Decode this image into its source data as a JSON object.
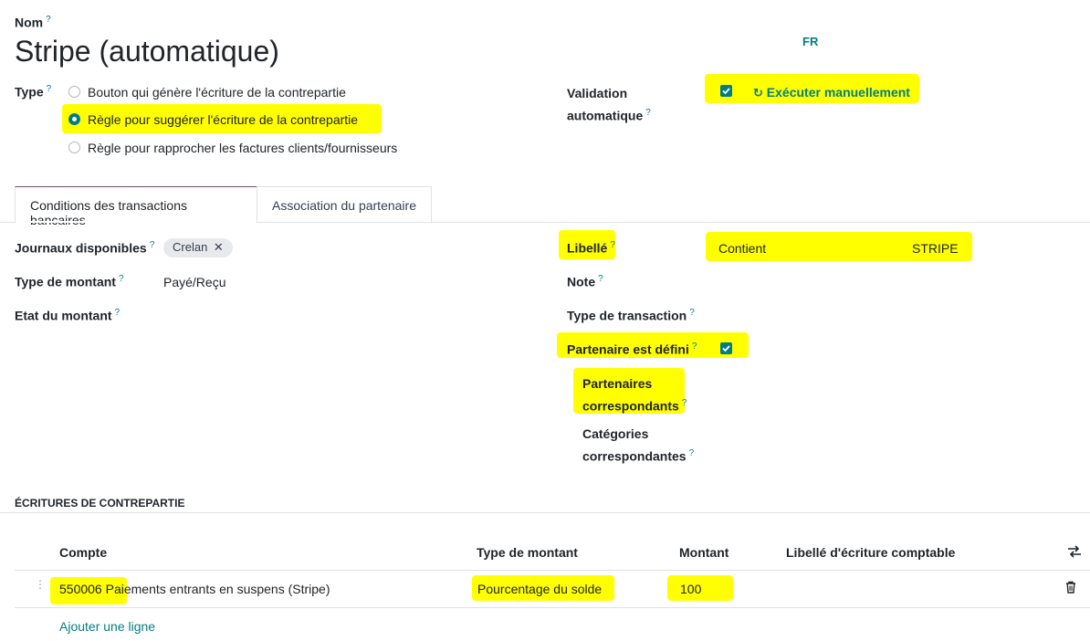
{
  "name": {
    "label": "Nom",
    "help": "?",
    "value": "Stripe (automatique)"
  },
  "lang": "FR",
  "type": {
    "label": "Type",
    "help": "?",
    "options": [
      "Bouton qui génère l'écriture de la contrepartie",
      "Règle pour suggérer l'écriture de la contrepartie",
      "Règle pour rapprocher les factures clients/fournisseurs"
    ],
    "selected_index": 1
  },
  "auto_validation": {
    "label_line1": "Validation",
    "label_line2": "automatique",
    "help": "?",
    "checked": true,
    "action_label": "Exécuter manuellement"
  },
  "tabs": [
    {
      "label": "Conditions des transactions bancaires",
      "active": true
    },
    {
      "label": "Association du partenaire",
      "active": false
    }
  ],
  "left_fields": {
    "journals": {
      "label": "Journaux disponibles",
      "help": "?",
      "tag": "Crelan"
    },
    "amount_type": {
      "label": "Type de montant",
      "help": "?",
      "value": "Payé/Reçu"
    },
    "amount_state": {
      "label": "Etat du montant",
      "help": "?"
    }
  },
  "right_fields": {
    "libelle": {
      "label": "Libellé",
      "help": "?",
      "operator": "Contient",
      "value": "STRIPE"
    },
    "note": {
      "label": "Note",
      "help": "?"
    },
    "transaction_type": {
      "label": "Type de transaction",
      "help": "?"
    },
    "partner_set": {
      "label": "Partenaire est défini",
      "help": "?",
      "checked": true
    },
    "matching_partners": {
      "label_line1": "Partenaires",
      "label_line2": "correspondants",
      "help": "?"
    },
    "matching_categories": {
      "label_line1": "Catégories",
      "label_line2": "correspondantes",
      "help": "?"
    }
  },
  "counterpart": {
    "section_title": "ÉCRITURES DE CONTREPARTIE",
    "columns": [
      "Compte",
      "Type de montant",
      "Montant",
      "Libellé d'écriture comptable"
    ],
    "rows": [
      {
        "account": "550006 Paiements entrants en suspens (Stripe)",
        "amount_type": "Pourcentage du solde",
        "amount": "100",
        "label": ""
      }
    ],
    "add_line": "Ajouter une ligne"
  },
  "colors": {
    "accent": "#017e84",
    "highlight": "#ffff00",
    "tab_active_border": "#714b67"
  }
}
